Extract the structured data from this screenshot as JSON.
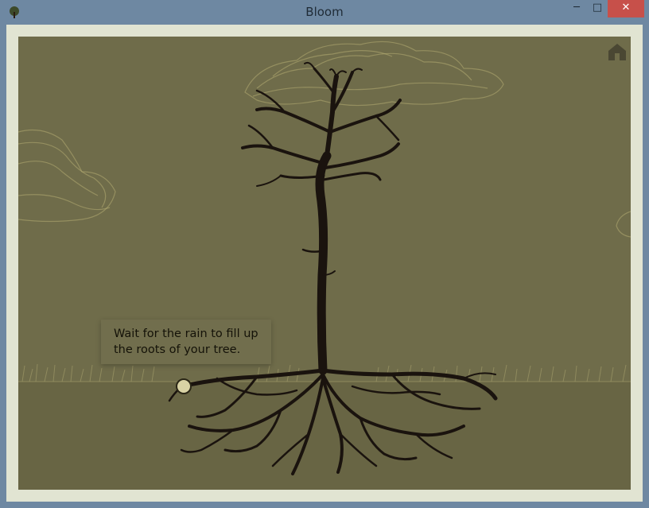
{
  "window": {
    "title": "Bloom",
    "controls": {
      "minimize": "─",
      "maximize": "□",
      "close": "✕"
    }
  },
  "game": {
    "tooltip": {
      "line1": "Wait for the rain to fill up",
      "line2": "the roots of your tree."
    },
    "icons": {
      "app": "tree-icon",
      "home": "home-icon"
    },
    "colors": {
      "sky": "#6f6c4a",
      "ground": "#686544",
      "tree": "#1a130e",
      "cloud": "#b4ad73",
      "drop": "#d9d3a5"
    }
  }
}
